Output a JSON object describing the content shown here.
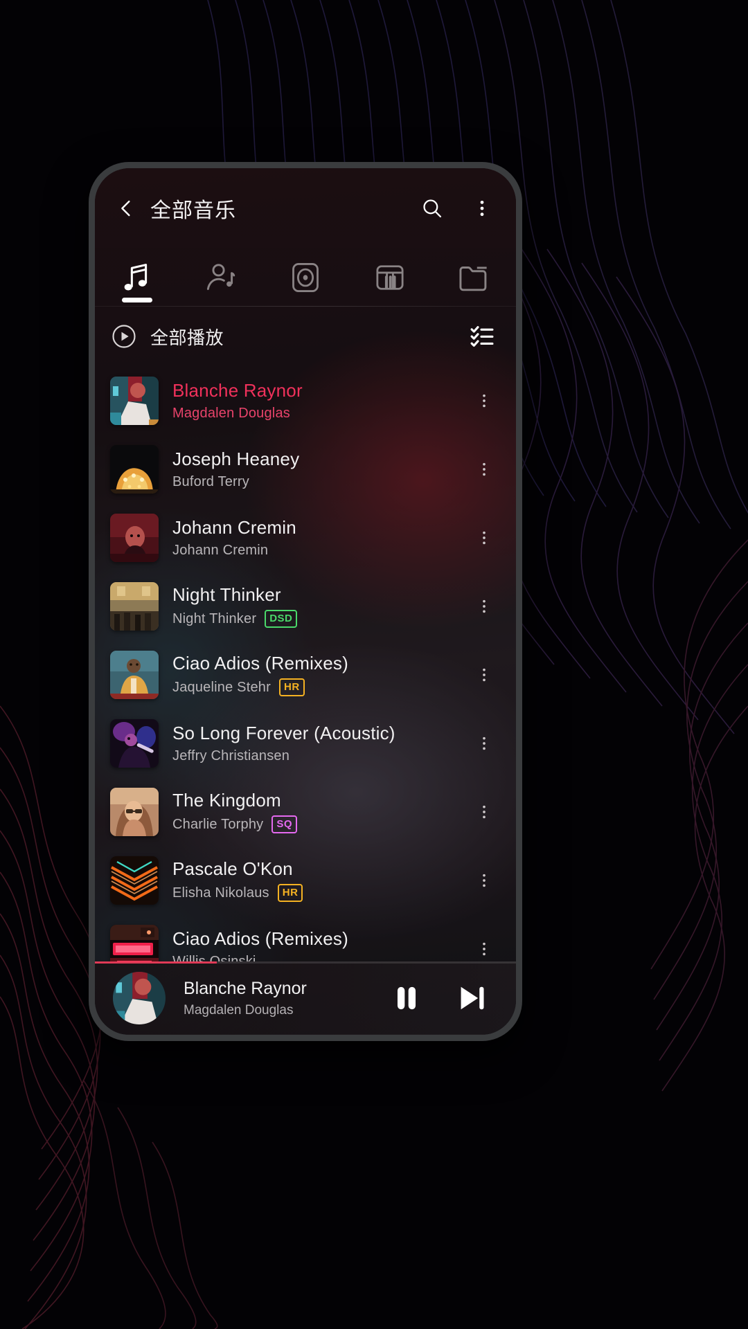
{
  "wallpaper": {
    "description": "dark topographic contour lines"
  },
  "appbar": {
    "back_icon": "chevron-left-icon",
    "title": "全部音乐",
    "search_icon": "search-icon",
    "overflow_icon": "more-vertical-icon"
  },
  "tabs": [
    {
      "icon": "music-note-icon",
      "name": "songs",
      "active": true
    },
    {
      "icon": "artist-icon",
      "name": "artists",
      "active": false
    },
    {
      "icon": "album-disc-icon",
      "name": "albums",
      "active": false
    },
    {
      "icon": "piano-keys-icon",
      "name": "genres",
      "active": false
    },
    {
      "icon": "folder-icon",
      "name": "folders",
      "active": false
    }
  ],
  "playall": {
    "play_icon": "play-circle-icon",
    "label": "全部播放",
    "multiselect_icon": "checklist-icon"
  },
  "songs": [
    {
      "title": "Blanche Raynor",
      "artist": "Magdalen Douglas",
      "badge": "",
      "badge_color": "",
      "playing": true,
      "art": "portrait-red-teal"
    },
    {
      "title": "Joseph Heaney",
      "artist": "Buford Terry",
      "badge": "",
      "badge_color": "",
      "playing": false,
      "art": "carousel-lights"
    },
    {
      "title": "Johann Cremin",
      "artist": "Johann Cremin",
      "badge": "",
      "badge_color": "",
      "playing": false,
      "art": "red-portrait"
    },
    {
      "title": "Night Thinker",
      "artist": "Night Thinker",
      "badge": "DSD",
      "badge_color": "#4ad96a",
      "playing": false,
      "art": "street-crowd"
    },
    {
      "title": "Ciao Adios (Remixes)",
      "artist": "Jaqueline Stehr",
      "badge": "HR",
      "badge_color": "#f5b game",
      "playing": false,
      "art": "yellow-jacket"
    },
    {
      "title": "So Long Forever (Acoustic)",
      "artist": "Jeffry Christiansen",
      "badge": "",
      "badge_color": "",
      "playing": false,
      "art": "concert-purple"
    },
    {
      "title": "The Kingdom",
      "artist": "Charlie Torphy",
      "badge": "SQ",
      "badge_color": "#e569f0",
      "playing": false,
      "art": "woman-glasses"
    },
    {
      "title": "Pascale O'Kon",
      "artist": "Elisha Nikolaus",
      "badge": "HR",
      "badge_color": "#f5b222",
      "playing": false,
      "art": "neon-chevrons"
    },
    {
      "title": "Ciao Adios (Remixes)",
      "artist": "Willis Osinski",
      "badge": "",
      "badge_color": "",
      "playing": false,
      "art": "neon-bar"
    }
  ],
  "miniplayer": {
    "title": "Blanche Raynor",
    "artist": "Magdalen Douglas",
    "pause_icon": "pause-icon",
    "next_icon": "skip-next-icon",
    "progress_percent": 29,
    "progress_color": "#e03a56"
  },
  "colors": {
    "accent_playing": "#f0315b",
    "badge_dsd": "#4ad96a",
    "badge_hr": "#f5b222",
    "badge_sq": "#e569f0"
  }
}
